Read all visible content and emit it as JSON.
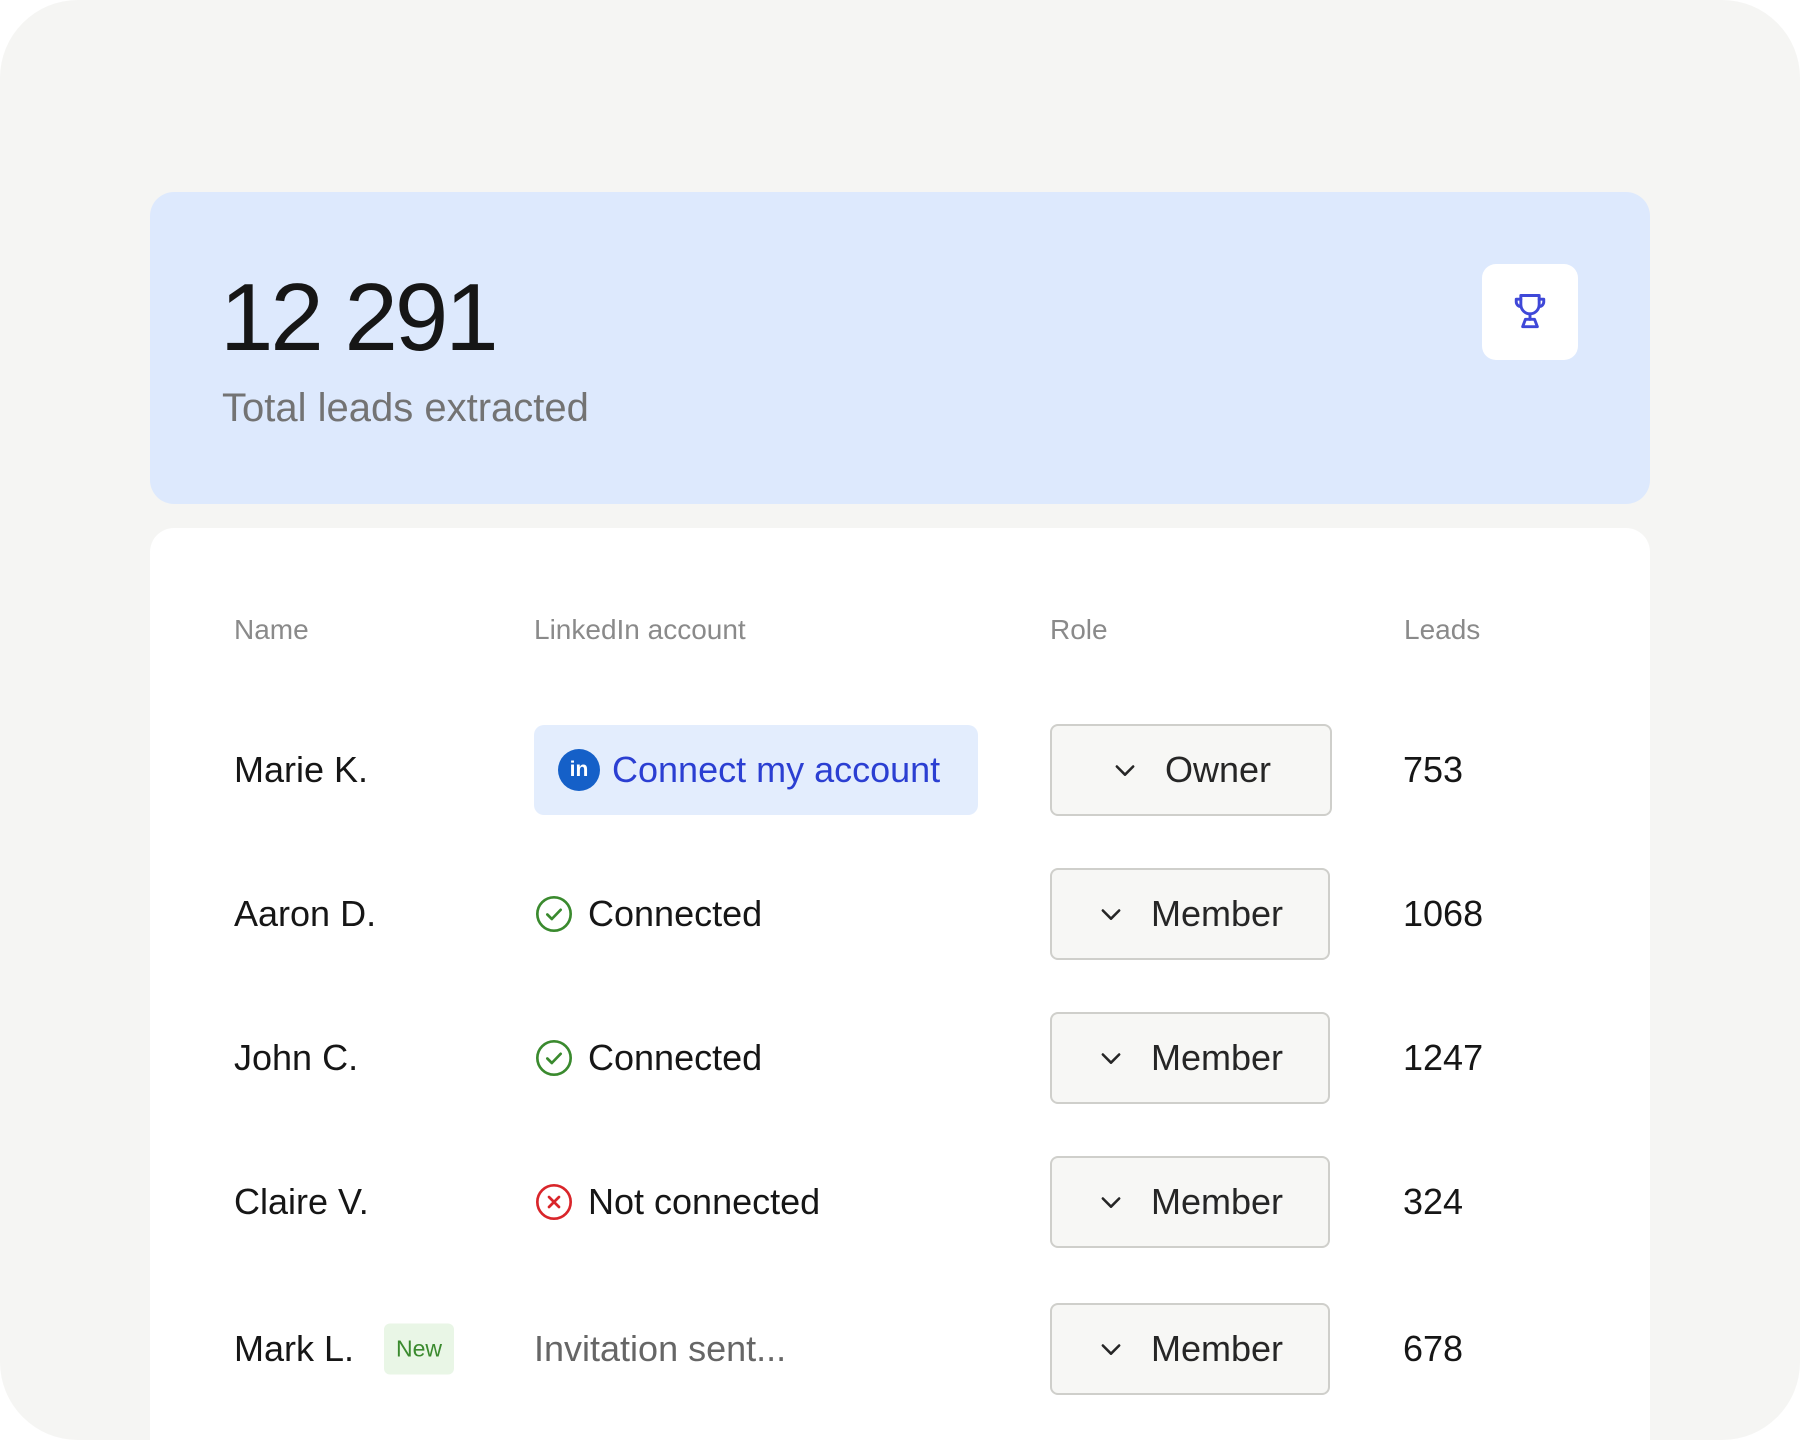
{
  "stats": {
    "total_leads": "12 291",
    "label": "Total leads extracted",
    "icon": "trophy-icon"
  },
  "table": {
    "headers": {
      "name": "Name",
      "linkedin": "LinkedIn account",
      "role": "Role",
      "leads": "Leads"
    },
    "rows": [
      {
        "name": "Marie K.",
        "badge": "",
        "linkedin_status": "connect",
        "linkedin_label": "Connect my account",
        "role": "Owner",
        "leads": "753"
      },
      {
        "name": "Aaron D.",
        "badge": "",
        "linkedin_status": "connected",
        "linkedin_label": "Connected",
        "role": "Member",
        "leads": "1068"
      },
      {
        "name": "John C.",
        "badge": "",
        "linkedin_status": "connected",
        "linkedin_label": "Connected",
        "role": "Member",
        "leads": "1247"
      },
      {
        "name": "Claire V.",
        "badge": "",
        "linkedin_status": "not-connected",
        "linkedin_label": "Not connected",
        "role": "Member",
        "leads": "324"
      },
      {
        "name": "Mark L.",
        "badge": "New",
        "linkedin_status": "invited",
        "linkedin_label": "Invitation sent...",
        "role": "Member",
        "leads": "678"
      }
    ],
    "linkedin_icon_text": "in"
  },
  "colors": {
    "stat_card_bg": "#dde9fd",
    "accent_blue": "#2b3fd2",
    "linkedin_blue": "#1560c8",
    "connected_green": "#3a8a2e",
    "error_red": "#d9252a",
    "new_badge_bg": "#e9f6e6"
  }
}
